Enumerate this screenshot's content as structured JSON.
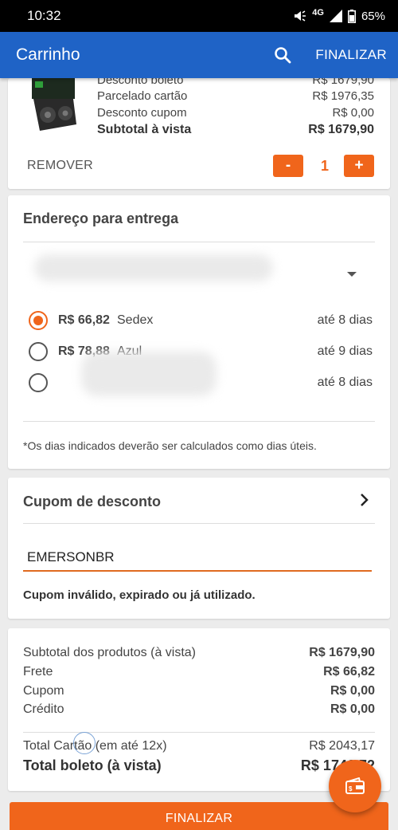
{
  "status_bar": {
    "time": "10:32",
    "network": "4G",
    "battery": "65%"
  },
  "app_bar": {
    "title": "Carrinho",
    "finalize_label": "FINALIZAR"
  },
  "product": {
    "rows": [
      {
        "label": "Desconto boleto",
        "value": "R$ 1679,90"
      },
      {
        "label": "Parcelado cartão",
        "value": "R$ 1976,35"
      },
      {
        "label": "Desconto cupom",
        "value": "R$ 0,00"
      },
      {
        "label": "Subtotal à vista",
        "value": "R$ 1679,90"
      }
    ],
    "remove_label": "REMOVER",
    "decrement_label": "-",
    "quantity": "1",
    "increment_label": "+"
  },
  "address": {
    "title": "Endereço para entrega",
    "shipping_options": [
      {
        "price": "R$ 66,82",
        "name": "Sedex",
        "days": "até 8 dias",
        "selected": true
      },
      {
        "price": "R$ 78,88",
        "name": "Azul",
        "days": "até 9 dias",
        "selected": false
      },
      {
        "price": "",
        "name": "",
        "days": "até 8 dias",
        "selected": false
      }
    ],
    "note": "*Os dias indicados deverão ser calculados como dias úteis."
  },
  "coupon": {
    "title": "Cupom de desconto",
    "value": "EMERSONBR",
    "error": "Cupom inválido, expirado ou já utilizado."
  },
  "summary": {
    "rows": [
      {
        "label": "Subtotal dos produtos (à vista)",
        "value": "R$ 1679,90"
      },
      {
        "label": "Frete",
        "value": "R$ 66,82"
      },
      {
        "label": "Cupom",
        "value": "R$ 0,00"
      },
      {
        "label": "Crédito",
        "value": "R$ 0,00"
      }
    ],
    "total_card_label": "Total Cartão (em até 12x)",
    "total_card_value": "R$ 2043,17",
    "total_boleto_label": "Total boleto (à vista)",
    "total_boleto_value": "R$ 1746,72"
  },
  "finalize_button_label": "FINALIZAR",
  "colors": {
    "primary_blue": "#1f63c6",
    "accent_orange": "#f0651b"
  },
  "icons": [
    "search-icon",
    "chevron-right-icon",
    "dropdown-arrow-icon",
    "wallet-icon"
  ]
}
